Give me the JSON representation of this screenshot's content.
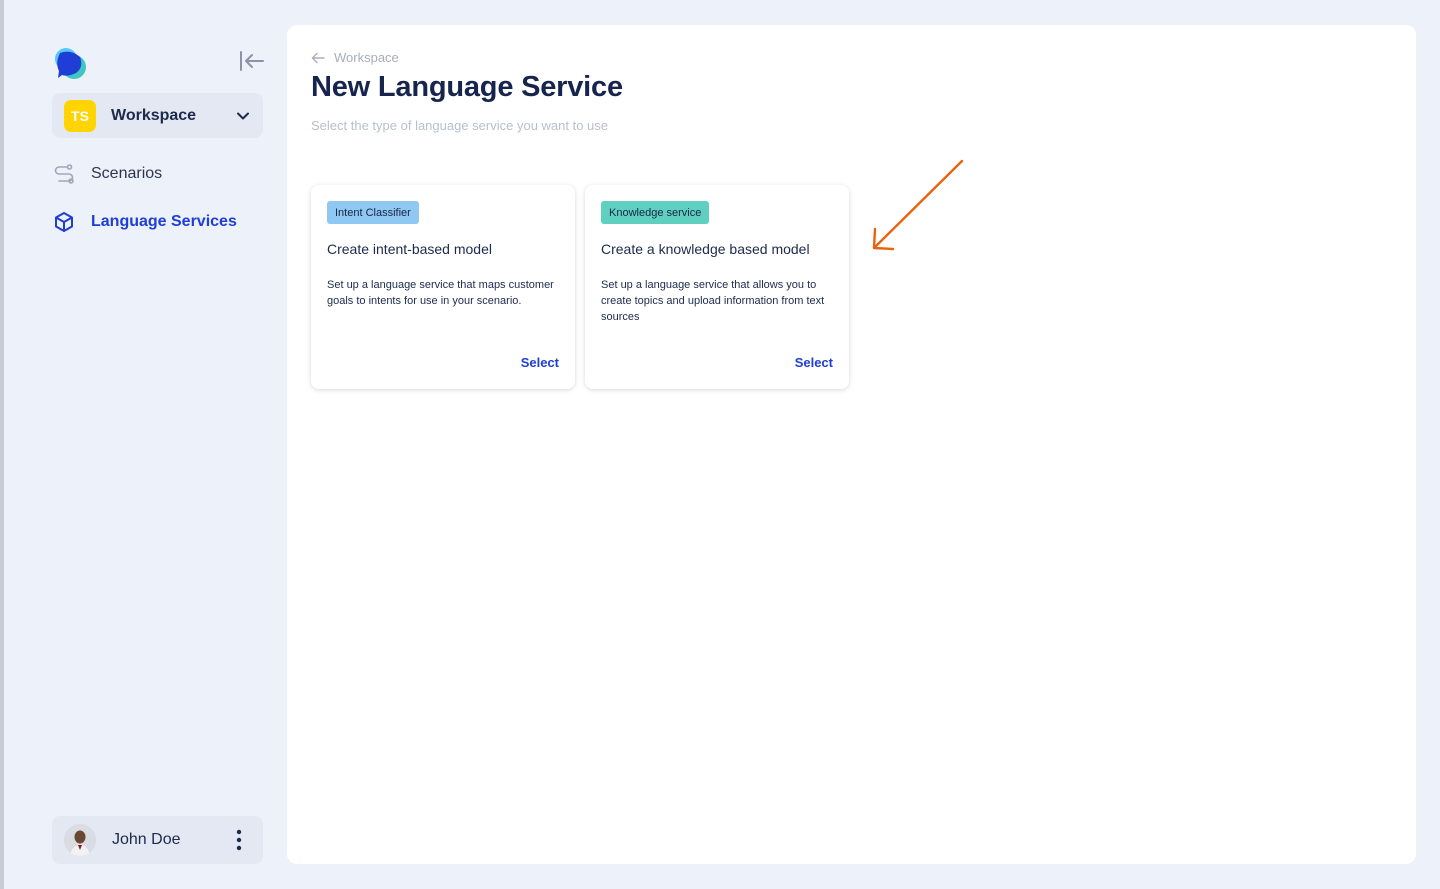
{
  "sidebar": {
    "workspace": {
      "initials": "TS",
      "name": "Workspace"
    },
    "nav": [
      {
        "label": "Scenarios",
        "icon": "route-icon",
        "active": false
      },
      {
        "label": "Language Services",
        "icon": "cube-icon",
        "active": true
      }
    ],
    "user": {
      "name": "John Doe"
    }
  },
  "main": {
    "breadcrumb": "Workspace",
    "title": "New Language Service",
    "subtitle": "Select the type of language service you want to use",
    "cards": [
      {
        "tag": "Intent Classifier",
        "title": "Create intent-based model",
        "description": "Set up a language service that maps customer goals to intents for use in your scenario.",
        "action": "Select"
      },
      {
        "tag": "Knowledge service",
        "title": "Create a knowledge based model",
        "description": "Set up a language service that allows you to create topics and upload information from text sources",
        "action": "Select"
      }
    ]
  },
  "colors": {
    "accent": "#1e3ed6",
    "annotation_arrow": "#e8620f",
    "intent_tag": "#8ec8f3",
    "knowledge_tag": "#5fd0bf",
    "workspace_badge": "#ffd400"
  }
}
